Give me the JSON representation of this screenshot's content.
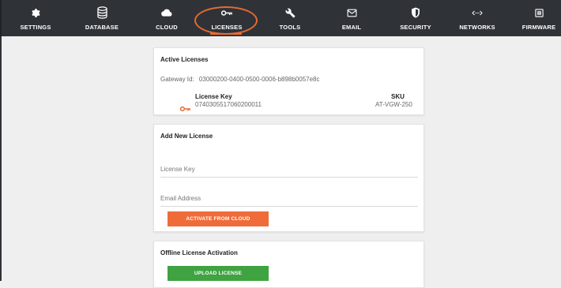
{
  "nav": {
    "items": [
      {
        "label": "SETTINGS",
        "icon": "gear-icon"
      },
      {
        "label": "DATABASE",
        "icon": "database-icon"
      },
      {
        "label": "CLOUD",
        "icon": "cloud-icon"
      },
      {
        "label": "LICENSES",
        "icon": "key-icon"
      },
      {
        "label": "TOOLS",
        "icon": "wrench-icon"
      },
      {
        "label": "EMAIL",
        "icon": "email-icon"
      },
      {
        "label": "SECURITY",
        "icon": "shield-icon"
      },
      {
        "label": "NETWORKS",
        "icon": "network-icon"
      },
      {
        "label": "FIRMWARE",
        "icon": "chip-icon"
      }
    ],
    "active": "LICENSES",
    "accent": "#ea6a2e"
  },
  "active_licenses": {
    "title": "Active Licenses",
    "gateway_label": "Gateway Id:",
    "gateway_id": "03000200-0400-0500-0006-b898b0057e8c",
    "license_key_header": "License Key",
    "sku_header": "SKU",
    "license_key": "0740305517060200011",
    "sku": "AT-VGW-250"
  },
  "add_license": {
    "title": "Add New License",
    "license_key_placeholder": "License Key",
    "email_placeholder": "Email Address",
    "activate_button": "ACTIVATE FROM CLOUD",
    "button_color": "#ef6c3a"
  },
  "offline": {
    "title": "Offline License Activation",
    "upload_button": "UPLOAD LICENSE",
    "button_color": "#3fa341"
  }
}
